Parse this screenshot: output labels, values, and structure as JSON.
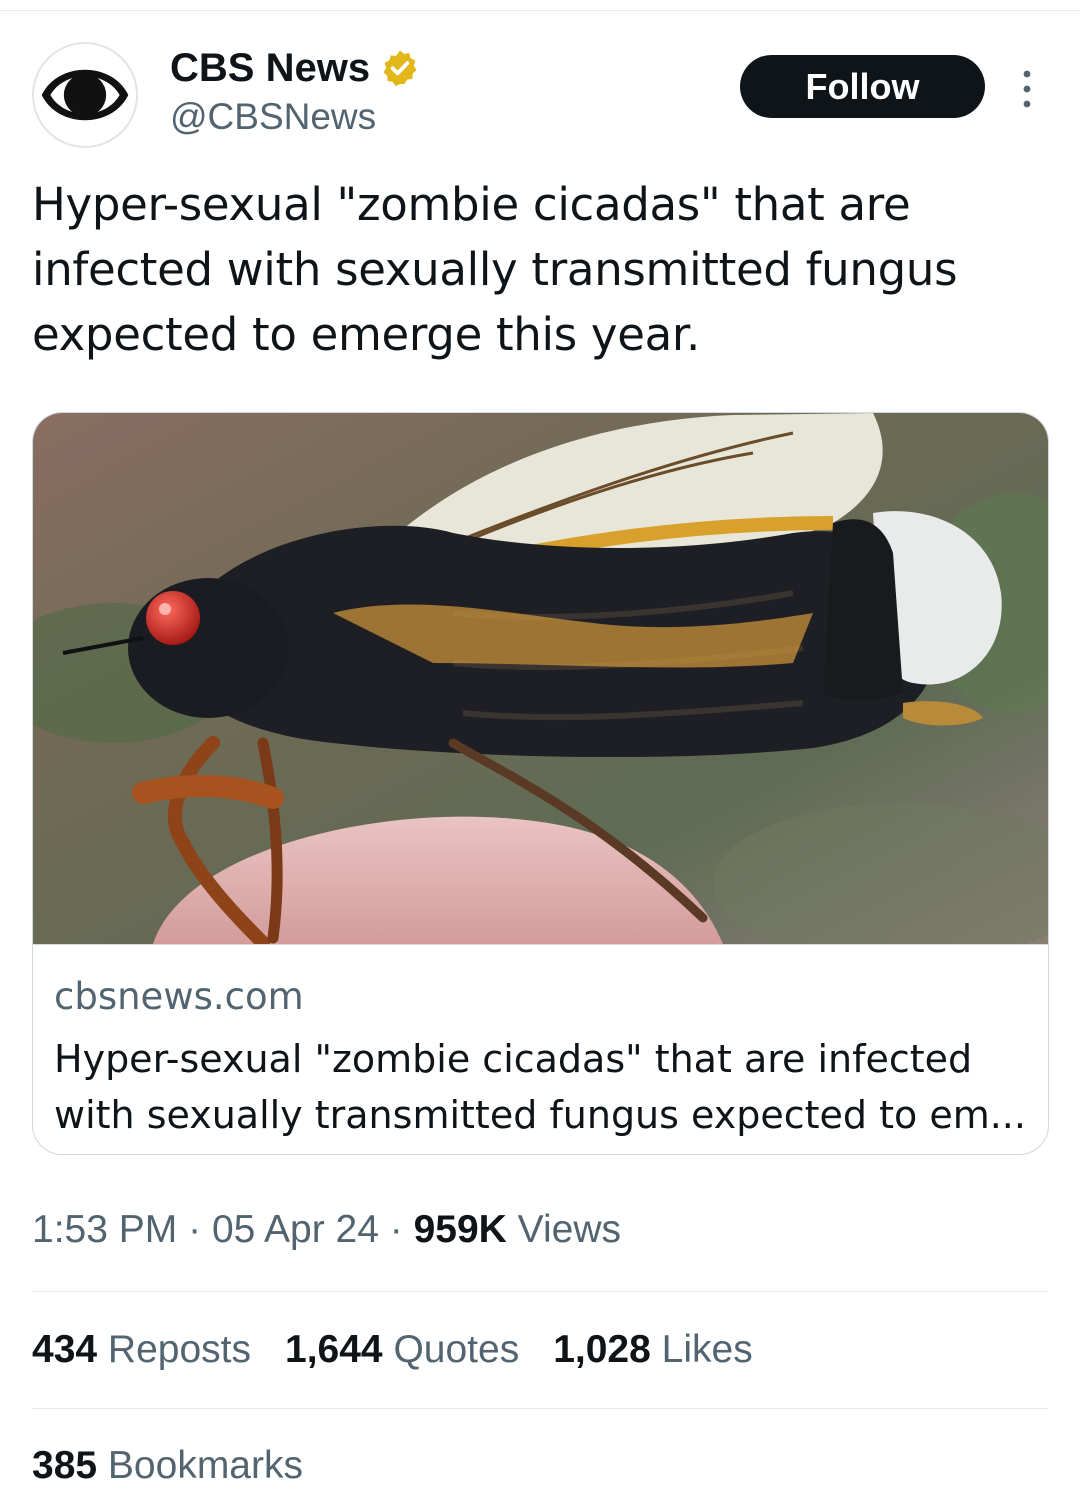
{
  "account": {
    "display_name": "CBS News",
    "handle": "@CBSNews",
    "verified_icon": "verified-badge-gold",
    "badge_color": "#e2b719",
    "follow_label": "Follow",
    "more_icon": "more-vertical-icon"
  },
  "tweet": {
    "text": "Hyper-sexual \"zombie cicadas\" that are infected with sexually transmitted fungus expected to emerge this year."
  },
  "card": {
    "domain": "cbsnews.com",
    "title": "Hyper-sexual \"zombie cicadas\" that are infected with sexually transmitted fungus expected to em..."
  },
  "meta": {
    "time": "1:53 PM",
    "date": "05 Apr 24",
    "separator": "·",
    "views_count": "959K",
    "views_label": "Views"
  },
  "stats": {
    "reposts_count": "434",
    "reposts_label": "Reposts",
    "quotes_count": "1,644",
    "quotes_label": "Quotes",
    "likes_count": "1,028",
    "likes_label": "Likes",
    "bookmarks_count": "385",
    "bookmarks_label": "Bookmarks"
  }
}
